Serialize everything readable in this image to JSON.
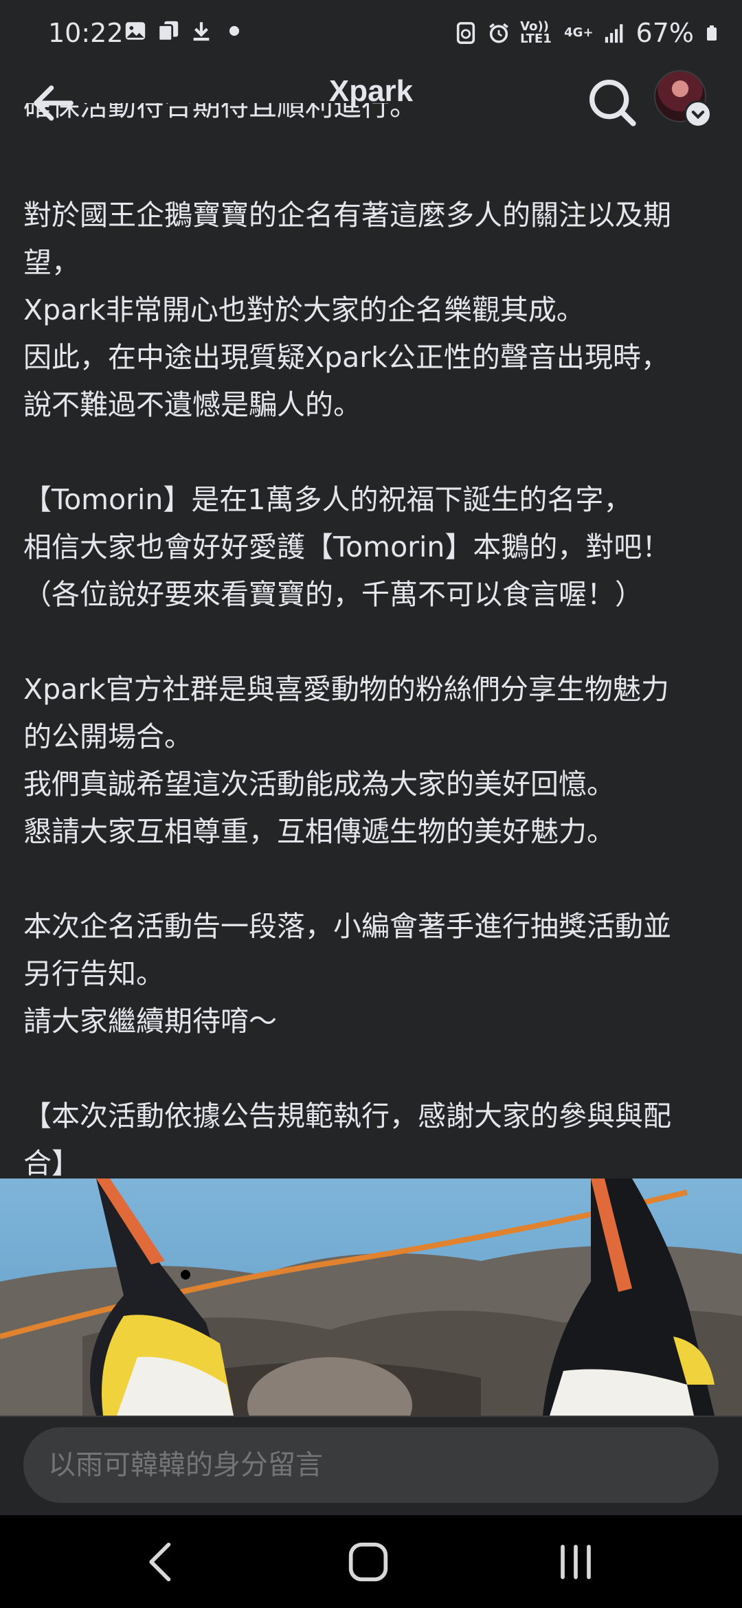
{
  "status_bar": {
    "time": "10:22",
    "left_icons": [
      "image-icon",
      "copy-icon",
      "download-icon",
      "dot-icon"
    ],
    "right_icons": [
      "recycle-icon",
      "alarm-icon",
      "volte-icon",
      "4g-icon",
      "signal-icon"
    ],
    "volte_label": "Vo)) LTE1",
    "network_label": "4G+",
    "battery_percent": "67%"
  },
  "app_bar": {
    "title": "Xpark",
    "back_icon": "arrow-left-icon",
    "search_icon": "search-icon"
  },
  "post": {
    "cut_line": "確保活動符合期待且順利進行。",
    "lines": [
      "對於國王企鵝寶寶的企名有著這麼多人的關注以及期",
      "望，",
      "Xpark非常開心也對於大家的企名樂觀其成。",
      "因此，在中途出現質疑Xpark公正性的聲音出現時，",
      "說不難過不遺憾是騙人的。",
      "",
      "【Tomorin】是在1萬多人的祝福下誕生的名字，",
      "相信大家也會好好愛護【Tomorin】本鵝的，對吧！",
      "（各位說好要來看寶寶的，千萬不可以食言喔！）",
      "",
      "Xpark官方社群是與喜愛動物的粉絲們分享生物魅力",
      "的公開場合。",
      "我們真誠希望這次活動能成為大家的美好回憶。",
      "懇請大家互相尊重，互相傳遞生物的美好魅力。",
      "",
      "本次企名活動告一段落，小編會著手進行抽獎活動並",
      "另行告知。",
      "請大家繼續期待唷～",
      "",
      "【本次活動依據公告規範執行，感謝大家的參與與配",
      "合】"
    ]
  },
  "comment": {
    "placeholder": "以雨可韓韓的身分留言"
  },
  "colors": {
    "background": "#242527",
    "text": "#e4e6eb",
    "input_bg": "#3a3b3c",
    "nav_bg": "#000000"
  }
}
